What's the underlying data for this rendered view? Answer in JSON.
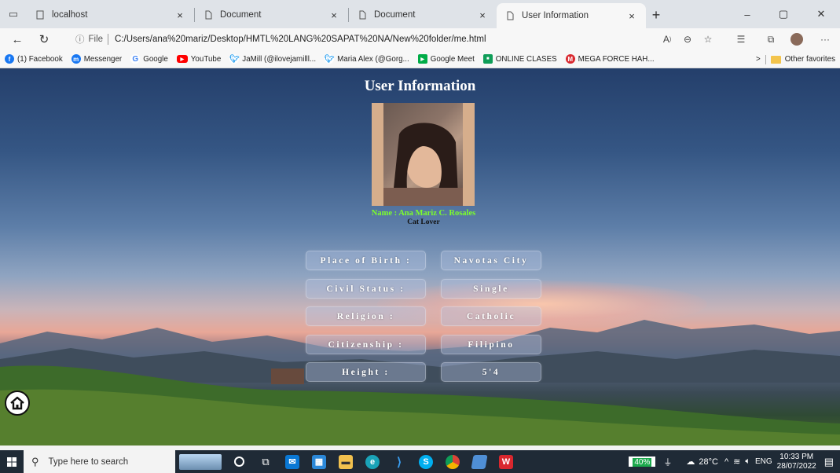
{
  "browser": {
    "tabs": [
      {
        "title": "localhost",
        "close": "×"
      },
      {
        "title": "Document",
        "close": "×"
      },
      {
        "title": "Document",
        "close": "×"
      },
      {
        "title": "User Information",
        "close": "×"
      }
    ],
    "new_tab": "+",
    "window": {
      "minimize": "–",
      "restore": "▢",
      "close": "✕"
    },
    "address": {
      "scheme": "File",
      "url": "C:/Users/ana%20mariz/Desktop/HMTL%20LANG%20SAPAT%20NA/New%20folder/me.html"
    },
    "favorites": [
      {
        "label": "(1) Facebook",
        "color": "#1877f2",
        "icon": "f"
      },
      {
        "label": "Messenger",
        "color": "#1877f2",
        "icon": "m"
      },
      {
        "label": "Google",
        "color": "#4285f4",
        "icon": "G"
      },
      {
        "label": "YouTube",
        "color": "#ff0000",
        "icon": "▶"
      },
      {
        "label": "JaMill (@ilovejamilll...",
        "color": "#1d9bf0",
        "icon": "t"
      },
      {
        "label": "Maria Alex (@Gorg...",
        "color": "#1d9bf0",
        "icon": "t"
      },
      {
        "label": "Google Meet",
        "color": "#00ac47",
        "icon": "▶"
      },
      {
        "label": "ONLINE CLASES",
        "color": "#0f9d58",
        "icon": "■"
      },
      {
        "label": "MEGA FORCE HAH...",
        "color": "#d9272e",
        "icon": "M"
      }
    ],
    "favorites_more": ">",
    "other_favorites": "Other favorites"
  },
  "page": {
    "title": "User Information",
    "name": "Name : Ana Mariz C. Rosales",
    "tagline": "Cat Lover",
    "name_color": "#7dff2a",
    "fields": [
      {
        "label": "Place of Birth :",
        "value": "Navotas City"
      },
      {
        "label": "Civil Status :",
        "value": "Single"
      },
      {
        "label": "Religion :",
        "value": "Catholic"
      },
      {
        "label": "Citizenship :",
        "value": "Filipino"
      },
      {
        "label": "Height :",
        "value": "5'4"
      }
    ]
  },
  "taskbar": {
    "search_placeholder": "Type here to search",
    "battery": "40%",
    "weather": "28°C",
    "language": "ENG",
    "time": "10:33 PM",
    "date": "28/07/2022"
  }
}
